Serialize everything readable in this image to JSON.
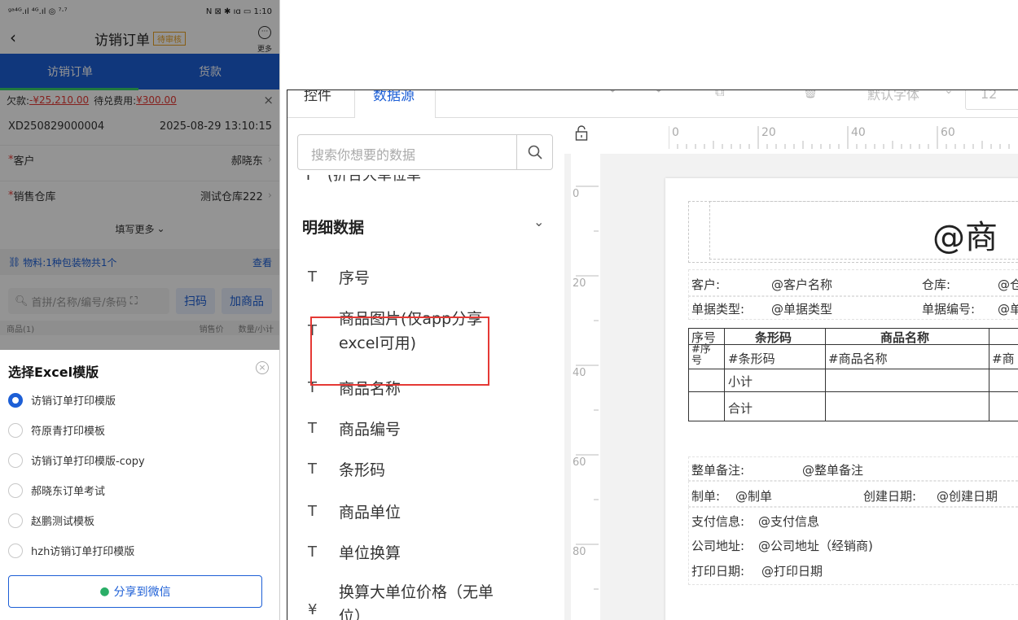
{
  "phone": {
    "status_left": "ᵍᵃ⁴ᴳ.ıl ⁴ᴳ.ıl ◎ ⁷·⁷",
    "status_right": "N ⊠ ✱ ıɑ ▭ 1:10",
    "title": "访销订单",
    "badge": "待审核",
    "more_label": "更多",
    "tabs": [
      "访销订单",
      "货款"
    ],
    "debt_label": "欠款:",
    "debt_value": "-¥25,210.00",
    "pending_label": "待兑费用:",
    "pending_value": "¥300.00",
    "order_no": "XD250829000004",
    "order_time": "2025-08-29 13:10:15",
    "customer_label": "客户",
    "customer_value": "郝晓东",
    "warehouse_label": "销售仓库",
    "warehouse_value": "测试仓库222",
    "fill_more": "填写更多",
    "material_text": "物料:1种包装物共1个",
    "view_label": "查看",
    "search_placeholder": "首拼/名称/编号/条码",
    "scan_label": "扫码",
    "add_goods_label": "加商品",
    "list_header_left": "商品(1)",
    "list_header_price": "销售价",
    "list_header_qty": "数量/小计",
    "sheet": {
      "title": "选择Excel模版",
      "options": [
        "访销订单打印模版",
        "符原青打印模板",
        "访销订单打印模版-copy",
        "郝晓东订单考试",
        "赵鹏测试模板",
        "hzh访销订单打印模版"
      ],
      "selected_index": 0,
      "share_label": "分享到微信"
    }
  },
  "desktop": {
    "tabs": [
      "控件",
      "数据源"
    ],
    "active_tab": 1,
    "toolbar_font": "默认字体",
    "toolbar_size": "12",
    "search_placeholder": "搜索你想要的数据",
    "section_title": "明细数据",
    "fields": [
      {
        "icon": "T",
        "label": "序号"
      },
      {
        "icon": "T",
        "label": "商品图片(仅app分享\nexcel可用)"
      },
      {
        "icon": "T",
        "label": "商品名称"
      },
      {
        "icon": "T",
        "label": "商品编号"
      },
      {
        "icon": "T",
        "label": "条形码"
      },
      {
        "icon": "T",
        "label": "商品单位"
      },
      {
        "icon": "T",
        "label": "单位换算"
      },
      {
        "icon": "¥",
        "label": "换算大单位价格（无单\n位）"
      }
    ],
    "ruler_h": [
      "0",
      "20",
      "40",
      "60"
    ],
    "ruler_v": [
      "0",
      "20",
      "40",
      "60",
      "80"
    ],
    "report": {
      "title": "@商",
      "customer_label": "客户:",
      "customer_value": "@客户名称",
      "warehouse_label": "仓库:",
      "warehouse_value": "@仓",
      "doctype_label": "单据类型:",
      "doctype_value": "@单据类型",
      "docno_label": "单据编号:",
      "docno_value": "@单",
      "col_seq": "序号",
      "col_barcode": "条形码",
      "col_name": "商品名称",
      "cell_seq": "#序\n号",
      "cell_barcode": "#条形码",
      "cell_name": "#商品名称",
      "cell_more": "#商",
      "subtotal": "小计",
      "total": "合计",
      "remark_label": "整单备注:",
      "remark_value": "@整单备注",
      "maker_label": "制单:",
      "maker_value": "@制单",
      "created_label": "创建日期:",
      "created_value": "@创建日期",
      "pay_label": "支付信息:",
      "pay_value": "@支付信息",
      "addr_label": "公司地址:",
      "addr_value": "@公司地址（经销商)",
      "print_label": "打印日期:",
      "print_value": "@打印日期"
    }
  }
}
